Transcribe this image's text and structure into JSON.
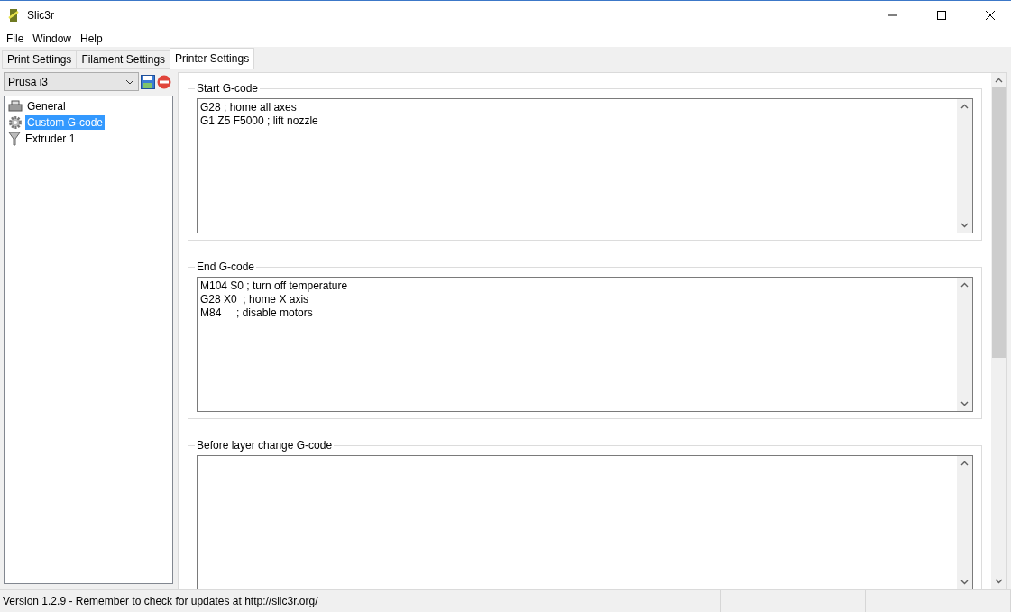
{
  "window": {
    "title": "Slic3r"
  },
  "menu": [
    "File",
    "Window",
    "Help"
  ],
  "tabs": [
    {
      "label": "Print Settings",
      "selected": false
    },
    {
      "label": "Filament Settings",
      "selected": false
    },
    {
      "label": "Printer Settings",
      "selected": true
    }
  ],
  "preset": {
    "value": "Prusa i3"
  },
  "sidebar": {
    "items": [
      {
        "label": "General",
        "kind": "printer",
        "selected": false
      },
      {
        "label": "Custom G-code",
        "kind": "gear",
        "selected": true
      },
      {
        "label": "Extruder 1",
        "kind": "funnel",
        "selected": false
      }
    ]
  },
  "sections": [
    {
      "title": "Start G-code",
      "value": "G28 ; home all axes\nG1 Z5 F5000 ; lift nozzle"
    },
    {
      "title": "End G-code",
      "value": "M104 S0 ; turn off temperature\nG28 X0  ; home X axis\nM84     ; disable motors"
    },
    {
      "title": "Before layer change G-code"
    }
  ],
  "status_bar": {
    "text": "Version 1.2.9 - Remember to check for updates at http://slic3r.org/"
  }
}
